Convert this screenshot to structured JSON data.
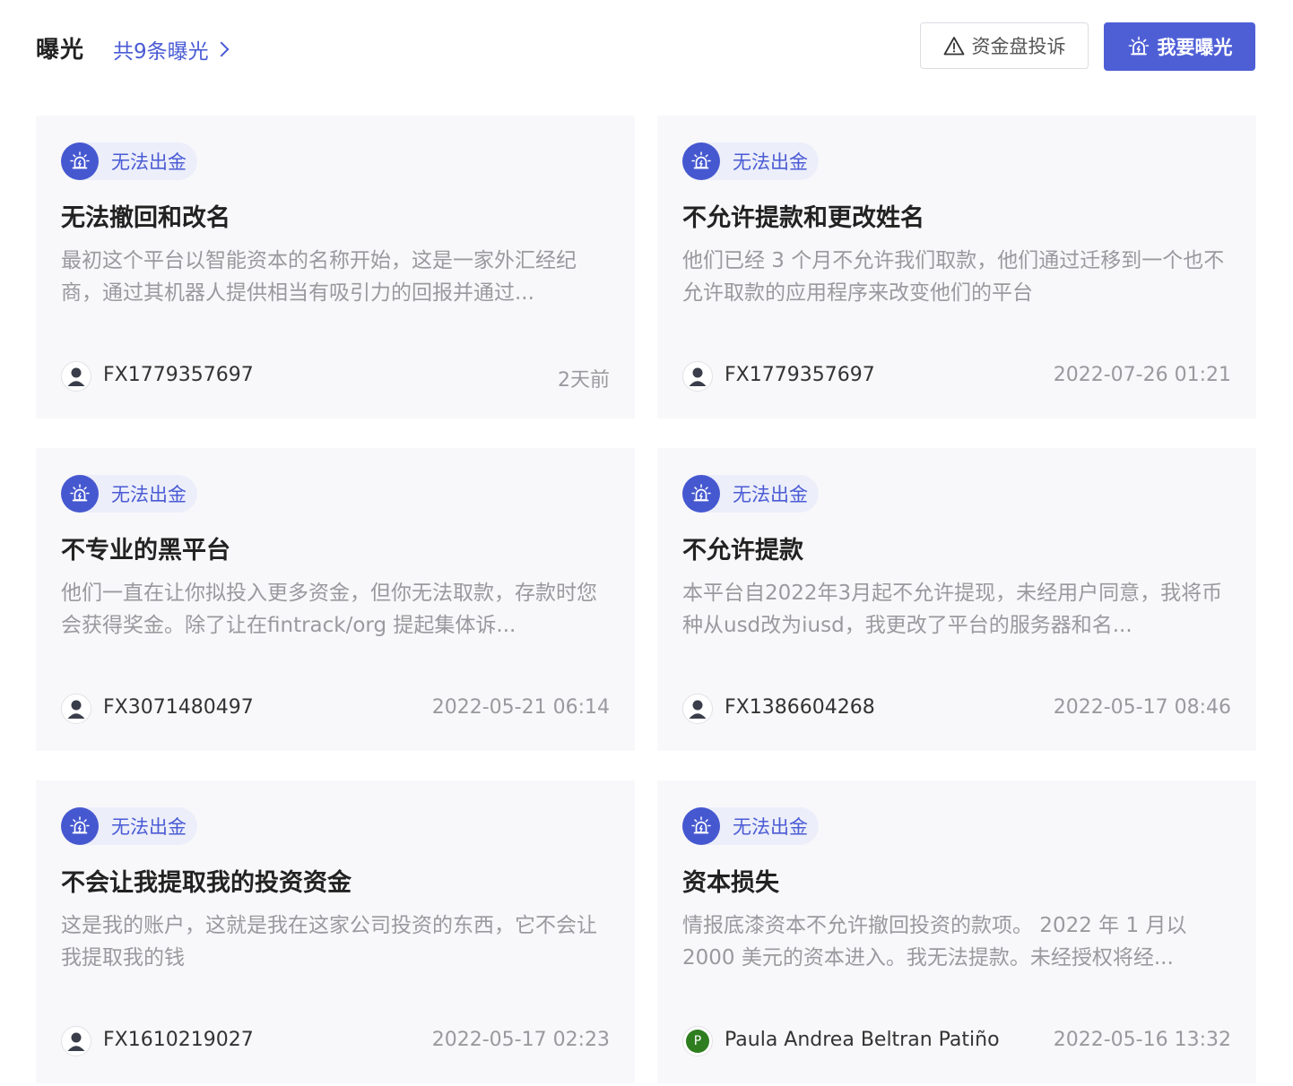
{
  "header": {
    "title": "曝光",
    "count_label": "共9条曝光",
    "complaint_button": "资金盘投诉",
    "expose_button": "我要曝光"
  },
  "colors": {
    "accent": "#4e5fd6",
    "tag_bg": "#eceefa",
    "card_bg": "#f8f8fa"
  },
  "cards": [
    {
      "tag": "无法出金",
      "title": "无法撤回和改名",
      "desc": "最初这个平台以智能资本的名称开始，这是一家外汇经纪商，通过其机器人提供相当有吸引力的回报并通过...",
      "user": "FX1779357697",
      "time": "2天前",
      "avatar": "default-user"
    },
    {
      "tag": "无法出金",
      "title": "不允许提款和更改姓名",
      "desc": "他们已经 3 个月不允许我们取款，他们通过迁移到一个也不允许取款的应用程序来改变他们的平台",
      "user": "FX1779357697",
      "time": "2022-07-26 01:21",
      "avatar": "default-user"
    },
    {
      "tag": "无法出金",
      "title": "不专业的黑平台",
      "desc": "他们一直在让你拟投入更多资金，但你无法取款，存款时您会获得奖金。除了让在fintrack/org 提起集体诉...",
      "user": "FX3071480497",
      "time": "2022-05-21 06:14",
      "avatar": "default-user"
    },
    {
      "tag": "无法出金",
      "title": "不允许提款",
      "desc": "本平台自2022年3月起不允许提现，未经用户同意，我将币种从usd改为iusd，我更改了平台的服务器和名...",
      "user": "FX1386604268",
      "time": "2022-05-17 08:46",
      "avatar": "default-user"
    },
    {
      "tag": "无法出金",
      "title": "不会让我提取我的投资资金",
      "desc": "这是我的账户，这就是我在这家公司投资的东西，它不会让我提取我的钱",
      "user": "FX1610219027",
      "time": "2022-05-17 02:23",
      "avatar": "default-user"
    },
    {
      "tag": "无法出金",
      "title": "资本损失",
      "desc": "情报底漆资本不允许撤回投资的款项。 2022 年 1 月以 2000 美元的资本进入。我无法提款。未经授权将经...",
      "user": "Paula Andrea Beltran Patiño",
      "time": "2022-05-16 13:32",
      "avatar": "letter",
      "avatar_letter": "P"
    }
  ]
}
